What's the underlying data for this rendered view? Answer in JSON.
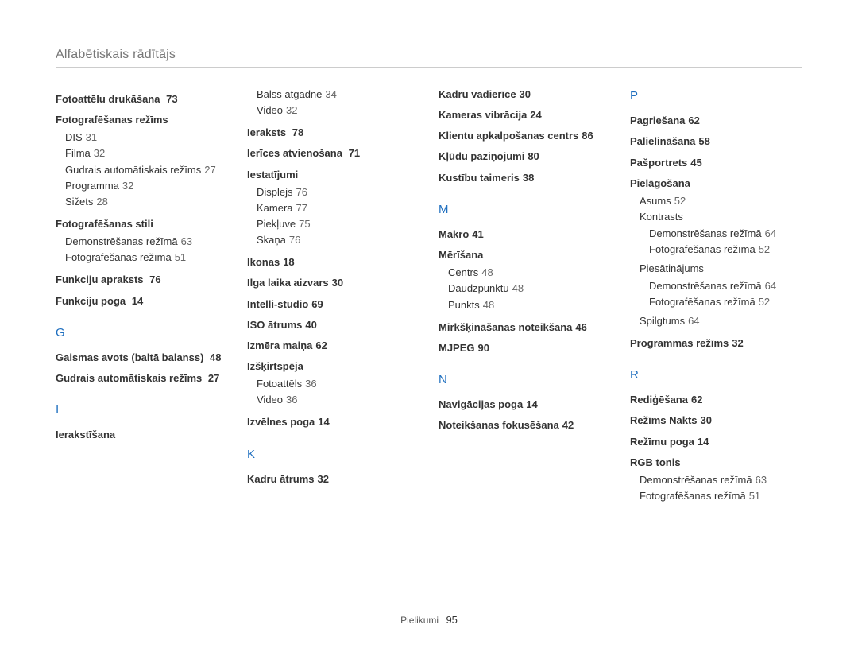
{
  "header": {
    "title": "Alfabētiskais rādītājs"
  },
  "footer": {
    "label": "Pielikumi",
    "page": "95"
  },
  "c1": {
    "foto_druk": {
      "label": "Fotoattēlu drukāšana",
      "p": "73"
    },
    "foto_rez": {
      "label": "Fotografēšanas režīms",
      "items": [
        {
          "label": "DIS",
          "p": "31"
        },
        {
          "label": "Filma",
          "p": "32"
        },
        {
          "label": "Gudrais automātiskais režīms",
          "p": "27"
        },
        {
          "label": "Programma",
          "p": "32"
        },
        {
          "label": "Sižets",
          "p": "28"
        }
      ]
    },
    "foto_stili": {
      "label": "Fotografēšanas stili",
      "items": [
        {
          "label": "Demonstrēšanas režīmā",
          "p": "63"
        },
        {
          "label": "Fotografēšanas režīmā",
          "p": "51"
        }
      ]
    },
    "funk_apraksts": {
      "label": "Funkciju apraksts",
      "p": "76"
    },
    "funk_poga": {
      "label": "Funkciju poga",
      "p": "14"
    },
    "g": "G",
    "gaismas": {
      "label": "Gaismas avots (baltā balanss)",
      "p": "48"
    },
    "gudrais": {
      "label": "Gudrais automātiskais režīms",
      "p": "27"
    },
    "i": "I",
    "ierakst": {
      "label": "Ierakstīšana"
    }
  },
  "c2": {
    "ierakst_sub": [
      {
        "label": "Balss atgādne",
        "p": "34"
      },
      {
        "label": "Video",
        "p": "32"
      }
    ],
    "ieraksts": {
      "label": "Ieraksts",
      "p": "78"
    },
    "ierices": {
      "label": "Ierīces atvienošana",
      "p": "71"
    },
    "iestat": {
      "label": "Iestatījumi",
      "items": [
        {
          "label": "Displejs",
          "p": "76"
        },
        {
          "label": "Kamera",
          "p": "77"
        },
        {
          "label": "Piekļuve",
          "p": "75"
        },
        {
          "label": "Skaņa",
          "p": "76"
        }
      ]
    },
    "ikonas": {
      "label": "Ikonas",
      "p": "18"
    },
    "ilga": {
      "label": "Ilga laika aizvars",
      "p": "30"
    },
    "intelli": {
      "label": "Intelli-studio",
      "p": "69"
    },
    "iso": {
      "label": "ISO ātrums",
      "p": "40"
    },
    "izmera": {
      "label": "Izmēra maiņa",
      "p": "62"
    },
    "izskirts": {
      "label": "Izšķirtspēja",
      "items": [
        {
          "label": "Fotoattēls",
          "p": "36"
        },
        {
          "label": "Video",
          "p": "36"
        }
      ]
    },
    "izvelnes": {
      "label": "Izvēlnes poga",
      "p": "14"
    },
    "k": "K",
    "kadru_atr": {
      "label": "Kadru ātrums",
      "p": "32"
    }
  },
  "c3": {
    "kadru_vad": {
      "label": "Kadru vadierīce",
      "p": "30"
    },
    "kameras_vib": {
      "label": "Kameras vibrācija",
      "p": "24"
    },
    "klientu": {
      "label": "Klientu apkalpošanas centrs",
      "p": "86"
    },
    "kludu": {
      "label": "Kļūdu paziņojumi",
      "p": "80"
    },
    "kustibu": {
      "label": "Kustību taimeris",
      "p": "38"
    },
    "m": "M",
    "makro": {
      "label": "Makro",
      "p": "41"
    },
    "merisana": {
      "label": "Mērīšana",
      "items": [
        {
          "label": "Centrs",
          "p": "48"
        },
        {
          "label": "Daudzpunktu",
          "p": "48"
        },
        {
          "label": "Punkts",
          "p": "48"
        }
      ]
    },
    "mirks": {
      "label": "Mirkšķināšanas noteikšana",
      "p": "46"
    },
    "mjpeg": {
      "label": "MJPEG",
      "p": "90"
    },
    "n": "N",
    "navig": {
      "label": "Navigācijas poga",
      "p": "14"
    },
    "noteik": {
      "label": "Noteikšanas fokusēšana",
      "p": "42"
    }
  },
  "c4": {
    "p": "P",
    "pagr": {
      "label": "Pagriešana",
      "p": "62"
    },
    "paliel": {
      "label": "Palielināšana",
      "p": "58"
    },
    "pasport": {
      "label": "Pašportrets",
      "p": "45"
    },
    "pielag": {
      "label": "Pielāgošana",
      "asums": {
        "label": "Asums",
        "p": "52"
      },
      "kontrasts": {
        "label": "Kontrasts",
        "items": [
          {
            "label": "Demonstrēšanas režīmā",
            "p": "64"
          },
          {
            "label": "Fotografēšanas režīmā",
            "p": "52"
          }
        ]
      },
      "piesat": {
        "label": "Piesātinājums",
        "items": [
          {
            "label": "Demonstrēšanas režīmā",
            "p": "64"
          },
          {
            "label": "Fotografēšanas režīmā",
            "p": "52"
          }
        ]
      },
      "spilgt": {
        "label": "Spilgtums",
        "p": "64"
      }
    },
    "prog_rez": {
      "label": "Programmas režīms",
      "p": "32"
    },
    "r": "R",
    "redig": {
      "label": "Rediģēšana",
      "p": "62"
    },
    "rez_nakts": {
      "label": "Režīms Nakts",
      "p": "30"
    },
    "rezimu_poga": {
      "label": "Režīmu poga",
      "p": "14"
    },
    "rgb": {
      "label": "RGB tonis",
      "items": [
        {
          "label": "Demonstrēšanas režīmā",
          "p": "63"
        },
        {
          "label": "Fotografēšanas režīmā",
          "p": "51"
        }
      ]
    }
  }
}
